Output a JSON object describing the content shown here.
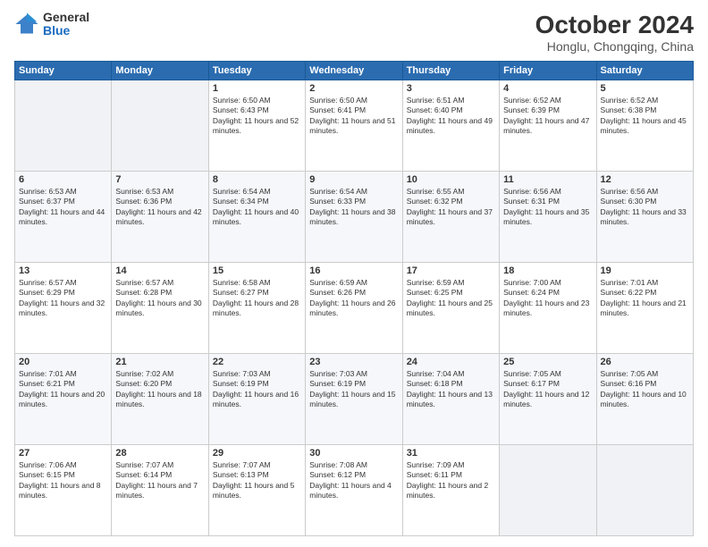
{
  "logo": {
    "general": "General",
    "blue": "Blue"
  },
  "header": {
    "month": "October 2024",
    "location": "Honglu, Chongqing, China"
  },
  "weekdays": [
    "Sunday",
    "Monday",
    "Tuesday",
    "Wednesday",
    "Thursday",
    "Friday",
    "Saturday"
  ],
  "weeks": [
    [
      {
        "day": "",
        "sunrise": "",
        "sunset": "",
        "daylight": ""
      },
      {
        "day": "",
        "sunrise": "",
        "sunset": "",
        "daylight": ""
      },
      {
        "day": "1",
        "sunrise": "Sunrise: 6:50 AM",
        "sunset": "Sunset: 6:43 PM",
        "daylight": "Daylight: 11 hours and 52 minutes."
      },
      {
        "day": "2",
        "sunrise": "Sunrise: 6:50 AM",
        "sunset": "Sunset: 6:41 PM",
        "daylight": "Daylight: 11 hours and 51 minutes."
      },
      {
        "day": "3",
        "sunrise": "Sunrise: 6:51 AM",
        "sunset": "Sunset: 6:40 PM",
        "daylight": "Daylight: 11 hours and 49 minutes."
      },
      {
        "day": "4",
        "sunrise": "Sunrise: 6:52 AM",
        "sunset": "Sunset: 6:39 PM",
        "daylight": "Daylight: 11 hours and 47 minutes."
      },
      {
        "day": "5",
        "sunrise": "Sunrise: 6:52 AM",
        "sunset": "Sunset: 6:38 PM",
        "daylight": "Daylight: 11 hours and 45 minutes."
      }
    ],
    [
      {
        "day": "6",
        "sunrise": "Sunrise: 6:53 AM",
        "sunset": "Sunset: 6:37 PM",
        "daylight": "Daylight: 11 hours and 44 minutes."
      },
      {
        "day": "7",
        "sunrise": "Sunrise: 6:53 AM",
        "sunset": "Sunset: 6:36 PM",
        "daylight": "Daylight: 11 hours and 42 minutes."
      },
      {
        "day": "8",
        "sunrise": "Sunrise: 6:54 AM",
        "sunset": "Sunset: 6:34 PM",
        "daylight": "Daylight: 11 hours and 40 minutes."
      },
      {
        "day": "9",
        "sunrise": "Sunrise: 6:54 AM",
        "sunset": "Sunset: 6:33 PM",
        "daylight": "Daylight: 11 hours and 38 minutes."
      },
      {
        "day": "10",
        "sunrise": "Sunrise: 6:55 AM",
        "sunset": "Sunset: 6:32 PM",
        "daylight": "Daylight: 11 hours and 37 minutes."
      },
      {
        "day": "11",
        "sunrise": "Sunrise: 6:56 AM",
        "sunset": "Sunset: 6:31 PM",
        "daylight": "Daylight: 11 hours and 35 minutes."
      },
      {
        "day": "12",
        "sunrise": "Sunrise: 6:56 AM",
        "sunset": "Sunset: 6:30 PM",
        "daylight": "Daylight: 11 hours and 33 minutes."
      }
    ],
    [
      {
        "day": "13",
        "sunrise": "Sunrise: 6:57 AM",
        "sunset": "Sunset: 6:29 PM",
        "daylight": "Daylight: 11 hours and 32 minutes."
      },
      {
        "day": "14",
        "sunrise": "Sunrise: 6:57 AM",
        "sunset": "Sunset: 6:28 PM",
        "daylight": "Daylight: 11 hours and 30 minutes."
      },
      {
        "day": "15",
        "sunrise": "Sunrise: 6:58 AM",
        "sunset": "Sunset: 6:27 PM",
        "daylight": "Daylight: 11 hours and 28 minutes."
      },
      {
        "day": "16",
        "sunrise": "Sunrise: 6:59 AM",
        "sunset": "Sunset: 6:26 PM",
        "daylight": "Daylight: 11 hours and 26 minutes."
      },
      {
        "day": "17",
        "sunrise": "Sunrise: 6:59 AM",
        "sunset": "Sunset: 6:25 PM",
        "daylight": "Daylight: 11 hours and 25 minutes."
      },
      {
        "day": "18",
        "sunrise": "Sunrise: 7:00 AM",
        "sunset": "Sunset: 6:24 PM",
        "daylight": "Daylight: 11 hours and 23 minutes."
      },
      {
        "day": "19",
        "sunrise": "Sunrise: 7:01 AM",
        "sunset": "Sunset: 6:22 PM",
        "daylight": "Daylight: 11 hours and 21 minutes."
      }
    ],
    [
      {
        "day": "20",
        "sunrise": "Sunrise: 7:01 AM",
        "sunset": "Sunset: 6:21 PM",
        "daylight": "Daylight: 11 hours and 20 minutes."
      },
      {
        "day": "21",
        "sunrise": "Sunrise: 7:02 AM",
        "sunset": "Sunset: 6:20 PM",
        "daylight": "Daylight: 11 hours and 18 minutes."
      },
      {
        "day": "22",
        "sunrise": "Sunrise: 7:03 AM",
        "sunset": "Sunset: 6:19 PM",
        "daylight": "Daylight: 11 hours and 16 minutes."
      },
      {
        "day": "23",
        "sunrise": "Sunrise: 7:03 AM",
        "sunset": "Sunset: 6:19 PM",
        "daylight": "Daylight: 11 hours and 15 minutes."
      },
      {
        "day": "24",
        "sunrise": "Sunrise: 7:04 AM",
        "sunset": "Sunset: 6:18 PM",
        "daylight": "Daylight: 11 hours and 13 minutes."
      },
      {
        "day": "25",
        "sunrise": "Sunrise: 7:05 AM",
        "sunset": "Sunset: 6:17 PM",
        "daylight": "Daylight: 11 hours and 12 minutes."
      },
      {
        "day": "26",
        "sunrise": "Sunrise: 7:05 AM",
        "sunset": "Sunset: 6:16 PM",
        "daylight": "Daylight: 11 hours and 10 minutes."
      }
    ],
    [
      {
        "day": "27",
        "sunrise": "Sunrise: 7:06 AM",
        "sunset": "Sunset: 6:15 PM",
        "daylight": "Daylight: 11 hours and 8 minutes."
      },
      {
        "day": "28",
        "sunrise": "Sunrise: 7:07 AM",
        "sunset": "Sunset: 6:14 PM",
        "daylight": "Daylight: 11 hours and 7 minutes."
      },
      {
        "day": "29",
        "sunrise": "Sunrise: 7:07 AM",
        "sunset": "Sunset: 6:13 PM",
        "daylight": "Daylight: 11 hours and 5 minutes."
      },
      {
        "day": "30",
        "sunrise": "Sunrise: 7:08 AM",
        "sunset": "Sunset: 6:12 PM",
        "daylight": "Daylight: 11 hours and 4 minutes."
      },
      {
        "day": "31",
        "sunrise": "Sunrise: 7:09 AM",
        "sunset": "Sunset: 6:11 PM",
        "daylight": "Daylight: 11 hours and 2 minutes."
      },
      {
        "day": "",
        "sunrise": "",
        "sunset": "",
        "daylight": ""
      },
      {
        "day": "",
        "sunrise": "",
        "sunset": "",
        "daylight": ""
      }
    ]
  ]
}
